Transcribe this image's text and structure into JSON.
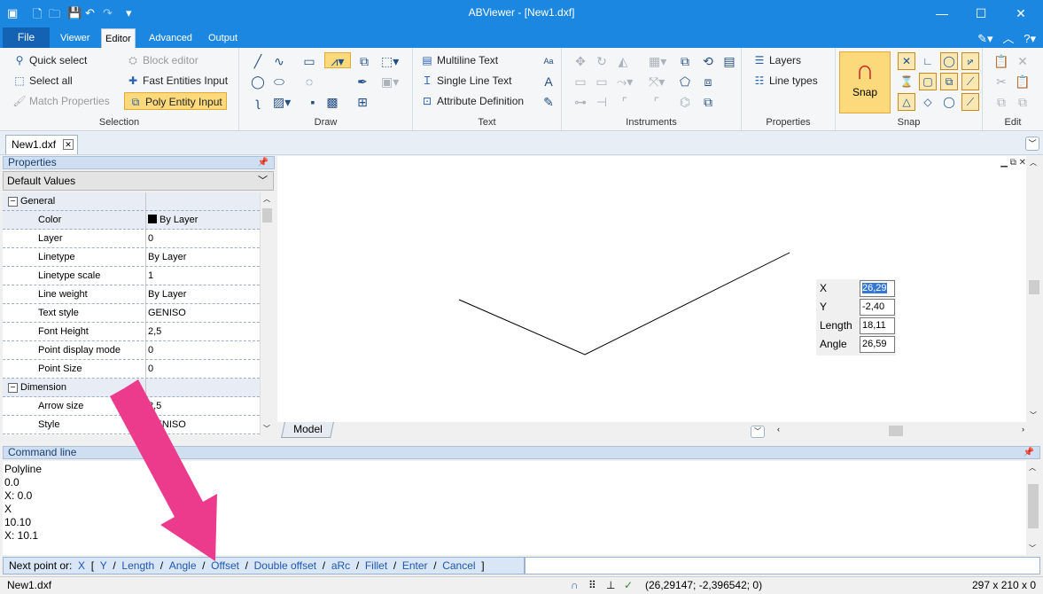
{
  "window": {
    "title": "ABViewer - [New1.dxf]",
    "minimize": "—",
    "maximize": "☐",
    "close": "✕"
  },
  "quick_access": [
    "save-icon",
    "new-icon",
    "open-icon",
    "undo-icon",
    "redo-icon"
  ],
  "tabs": {
    "file": "File",
    "items": [
      "Viewer",
      "Editor",
      "Advanced",
      "Output"
    ],
    "active": "Editor"
  },
  "ribbon": {
    "selection": {
      "label": "Selection",
      "quick_select": "Quick select",
      "select_all": "Select all",
      "match_properties": "Match Properties",
      "block_editor": "Block editor",
      "fast_entities": "Fast Entities Input",
      "poly_entity": "Poly Entity Input"
    },
    "draw": {
      "label": "Draw"
    },
    "text": {
      "label": "Text",
      "multiline": "Multiline Text",
      "single_line": "Single Line Text",
      "attribute": "Attribute Definition"
    },
    "instruments": {
      "label": "Instruments"
    },
    "properties": {
      "label": "Properties",
      "layers": "Layers",
      "line_types": "Line types"
    },
    "snap": {
      "label": "Snap",
      "snap_button": "Snap"
    },
    "edit": {
      "label": "Edit"
    }
  },
  "document_tab": {
    "name": "New1.dxf"
  },
  "properties_panel": {
    "title": "Properties",
    "preset": "Default Values",
    "sections": {
      "general": "General",
      "dimension": "Dimension"
    },
    "rows": [
      {
        "key": "Color",
        "value": "By Layer"
      },
      {
        "key": "Layer",
        "value": "0"
      },
      {
        "key": "Linetype",
        "value": "By Layer"
      },
      {
        "key": "Linetype scale",
        "value": "1"
      },
      {
        "key": "Line weight",
        "value": "By Layer"
      },
      {
        "key": "Text style",
        "value": "GENISO"
      },
      {
        "key": "Font Height",
        "value": "2,5"
      },
      {
        "key": "Point display mode",
        "value": "0"
      },
      {
        "key": "Point Size",
        "value": "0"
      }
    ],
    "dimension_rows": [
      {
        "key": "Arrow size",
        "value": "2,5"
      },
      {
        "key": "Style",
        "value": "GENISO"
      }
    ]
  },
  "canvas": {
    "model_tab": "Model"
  },
  "coord_entry": {
    "x_label": "X",
    "x_value": "26,29",
    "y_label": "Y",
    "y_value": "-2,40",
    "length_label": "Length",
    "length_value": "18,11",
    "angle_label": "Angle",
    "angle_value": "26,59"
  },
  "command_line": {
    "title": "Command line",
    "history": [
      "Polyline",
      "0.0",
      "X: 0.0",
      "X",
      "10.10",
      "X: 10.1"
    ],
    "prompt_label": "Next point or:",
    "prompt_x": "X",
    "options": [
      "Y",
      "Length",
      "Angle",
      "Offset",
      "Double offset",
      "aRc",
      "Fillet",
      "Enter",
      "Cancel"
    ]
  },
  "status_bar": {
    "file": "New1.dxf",
    "coords": "(26,29147; -2,396542; 0)",
    "sheet": "297 x 210 x 0"
  },
  "colors": {
    "accent": "#1c87e0",
    "highlight": "#fcd97a",
    "annotation_arrow": "#ec3b8d"
  }
}
